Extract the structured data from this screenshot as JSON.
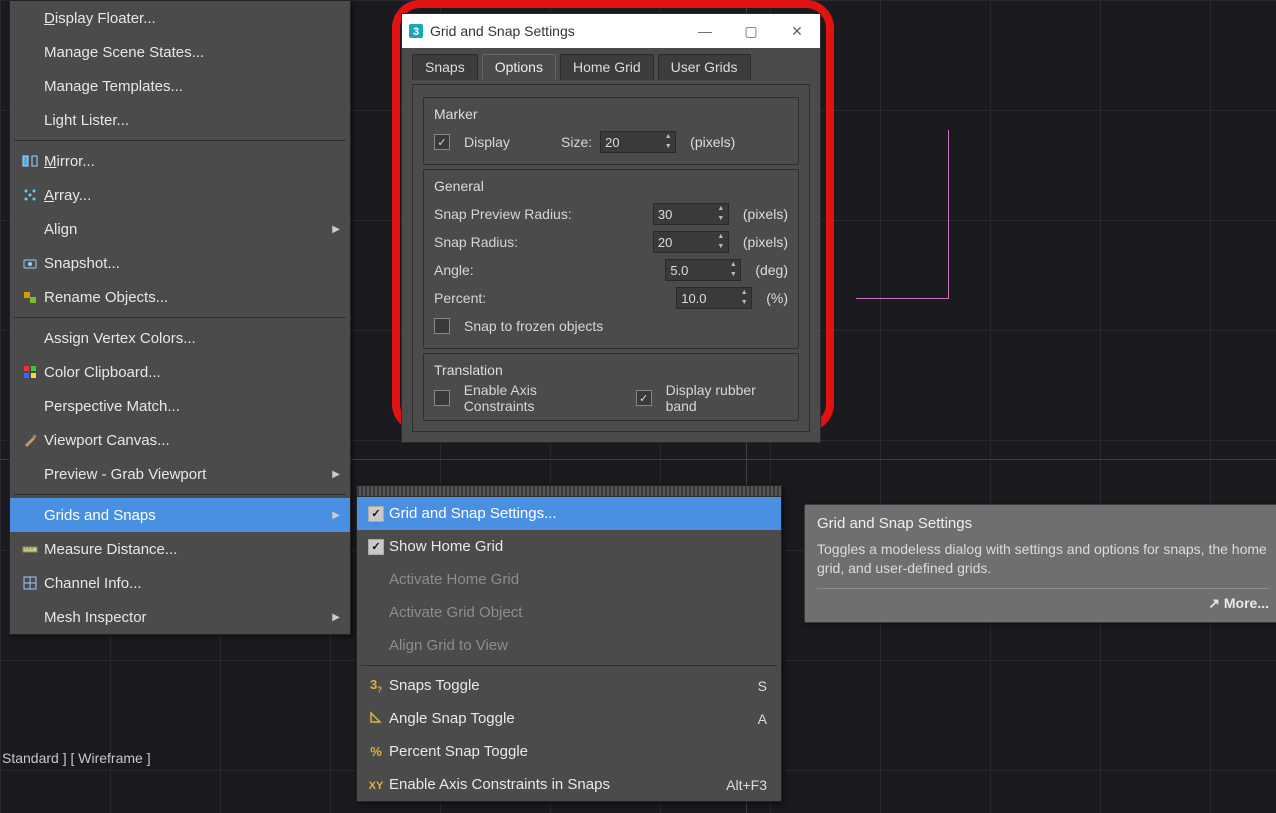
{
  "viewport_label": "Standard ] [ Wireframe ]",
  "menu": {
    "items": [
      {
        "label": "Display Floater...",
        "icon": "",
        "ul": "D"
      },
      {
        "label": "Manage Scene States...",
        "icon": ""
      },
      {
        "label": "Manage Templates...",
        "icon": ""
      },
      {
        "label": "Light Lister...",
        "icon": ""
      },
      {
        "type": "sep"
      },
      {
        "label": "Mirror...",
        "icon": "mirror",
        "ul": "M"
      },
      {
        "label": "Array...",
        "icon": "array",
        "ul": "A"
      },
      {
        "label": "Align",
        "icon": "",
        "sub": true
      },
      {
        "label": "Snapshot...",
        "icon": "snapshot"
      },
      {
        "label": "Rename Objects...",
        "icon": "rename"
      },
      {
        "type": "sep"
      },
      {
        "label": "Assign Vertex Colors...",
        "icon": ""
      },
      {
        "label": "Color Clipboard...",
        "icon": "palette"
      },
      {
        "label": "Perspective Match...",
        "icon": ""
      },
      {
        "label": "Viewport Canvas...",
        "icon": "brush"
      },
      {
        "label": "Preview - Grab Viewport",
        "icon": "",
        "sub": true
      },
      {
        "type": "sep"
      },
      {
        "label": "Grids and Snaps",
        "icon": "",
        "sub": true,
        "selected": true
      },
      {
        "label": "Measure Distance...",
        "icon": "ruler"
      },
      {
        "label": "Channel Info...",
        "icon": "grid"
      },
      {
        "label": "Mesh Inspector",
        "icon": "",
        "sub": true
      }
    ]
  },
  "submenu": {
    "items": [
      {
        "label": "Grid and Snap Settings...",
        "check": true,
        "selected": true
      },
      {
        "label": "Show Home Grid",
        "check": true
      },
      {
        "label": "Activate Home Grid",
        "disabled": true
      },
      {
        "label": "Activate Grid Object",
        "disabled": true
      },
      {
        "label": "Align Grid to View",
        "disabled": true
      },
      {
        "type": "sep"
      },
      {
        "label": "Snaps Toggle",
        "icon": "s3",
        "shortcut": "S"
      },
      {
        "label": "Angle Snap Toggle",
        "icon": "angle",
        "shortcut": "A"
      },
      {
        "label": "Percent Snap Toggle",
        "icon": "pct"
      },
      {
        "label": "Enable Axis Constraints in Snaps",
        "icon": "xy",
        "shortcut": "Alt+F3"
      }
    ]
  },
  "tooltip": {
    "title": "Grid and Snap Settings",
    "body": "Toggles a modeless dialog with settings and options for snaps, the home grid, and user-defined grids.",
    "more": "More..."
  },
  "dialog": {
    "title": "Grid and Snap Settings",
    "tabs": [
      "Snaps",
      "Options",
      "Home Grid",
      "User Grids"
    ],
    "active_tab": 1,
    "marker": {
      "legend": "Marker",
      "display_label": "Display",
      "display_checked": true,
      "size_label": "Size:",
      "size_value": "20",
      "size_unit": "(pixels)"
    },
    "general": {
      "legend": "General",
      "rows": [
        {
          "label": "Snap Preview Radius:",
          "value": "30",
          "unit": "(pixels)"
        },
        {
          "label": "Snap Radius:",
          "value": "20",
          "unit": "(pixels)"
        },
        {
          "label": "Angle:",
          "value": "5.0",
          "unit": "(deg)"
        },
        {
          "label": "Percent:",
          "value": "10.0",
          "unit": "(%)"
        }
      ],
      "frozen_label": "Snap to frozen objects",
      "frozen_checked": false
    },
    "translation": {
      "legend": "Translation",
      "axis_label": "Enable Axis Constraints",
      "axis_checked": false,
      "rubber_label": "Display rubber band",
      "rubber_checked": true
    }
  }
}
